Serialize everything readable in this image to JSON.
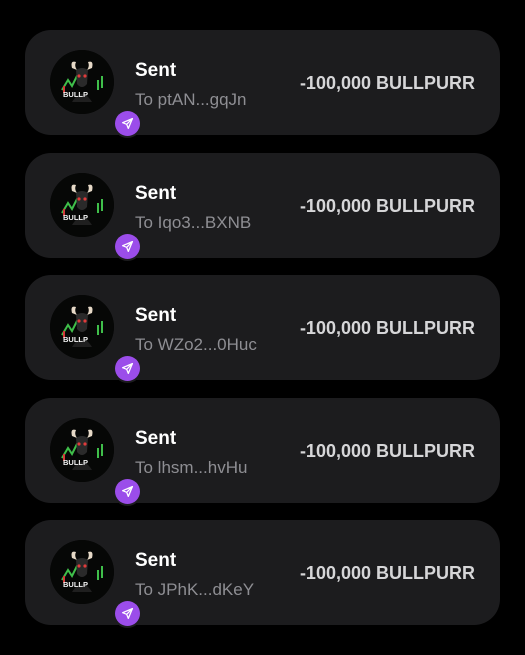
{
  "transactions": [
    {
      "title": "Sent",
      "recipient": "To ptAN...gqJn",
      "amount": "-100,000 BULLPURR",
      "token_logo_text": "BULLP",
      "token_icon": "bull-logo-icon",
      "type_icon": "send-arrow-icon"
    },
    {
      "title": "Sent",
      "recipient": "To Iqo3...BXNB",
      "amount": "-100,000 BULLPURR",
      "token_logo_text": "BULLP",
      "token_icon": "bull-logo-icon",
      "type_icon": "send-arrow-icon"
    },
    {
      "title": "Sent",
      "recipient": "To WZo2...0Huc",
      "amount": "-100,000 BULLPURR",
      "token_logo_text": "BULLP",
      "token_icon": "bull-logo-icon",
      "type_icon": "send-arrow-icon"
    },
    {
      "title": "Sent",
      "recipient": "To lhsm...hvHu",
      "amount": "-100,000 BULLPURR",
      "token_logo_text": "BULLP",
      "token_icon": "bull-logo-icon",
      "type_icon": "send-arrow-icon"
    },
    {
      "title": "Sent",
      "recipient": "To JPhK...dKeY",
      "amount": "-100,000 BULLPURR",
      "token_logo_text": "BULLP",
      "token_icon": "bull-logo-icon",
      "type_icon": "send-arrow-icon"
    }
  ],
  "colors": {
    "background": "#000000",
    "card": "#1c1c1e",
    "title": "#ffffff",
    "subtitle": "#8e8e93",
    "amount": "#d6d6d8",
    "badge": "#9b4dea"
  }
}
